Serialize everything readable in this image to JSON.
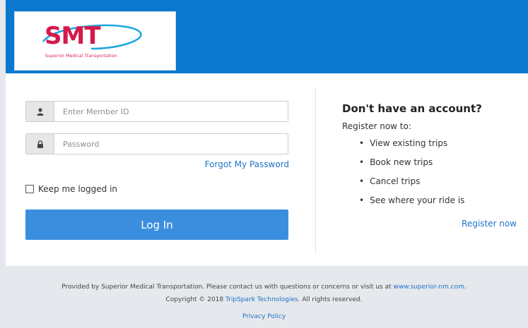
{
  "header": {
    "logo_text": "SMT",
    "logo_subtitle": "Superior Medical Transportation",
    "brand_color": "#0b79cf",
    "logo_color": "#d6194b"
  },
  "login": {
    "member_id_placeholder": "Enter Member ID",
    "member_id_value": "",
    "password_placeholder": "Password",
    "password_value": "",
    "forgot_label": "Forgot My Password",
    "keep_logged_in_label": "Keep me logged in",
    "keep_logged_in_checked": false,
    "login_label": "Log In",
    "user_icon": "user-icon",
    "lock_icon": "lock-icon"
  },
  "register": {
    "title": "Don't have an account?",
    "subtitle": "Register now to:",
    "benefits": [
      "View existing trips",
      "Book new trips",
      "Cancel trips",
      "See where your ride is"
    ],
    "link_label": "Register now"
  },
  "footer": {
    "text_prefix": "Provided by Superior Medical Transportation. Please contact us with questions or concerns or visit us at ",
    "website_link": "www.superior-nm.com",
    "text_suffix": ".",
    "copyright_prefix": "Copyright © 2018 ",
    "company_link": "TripSpark Technologies",
    "copyright_suffix": ". All rights reserved.",
    "privacy_label": "Privacy Policy"
  }
}
